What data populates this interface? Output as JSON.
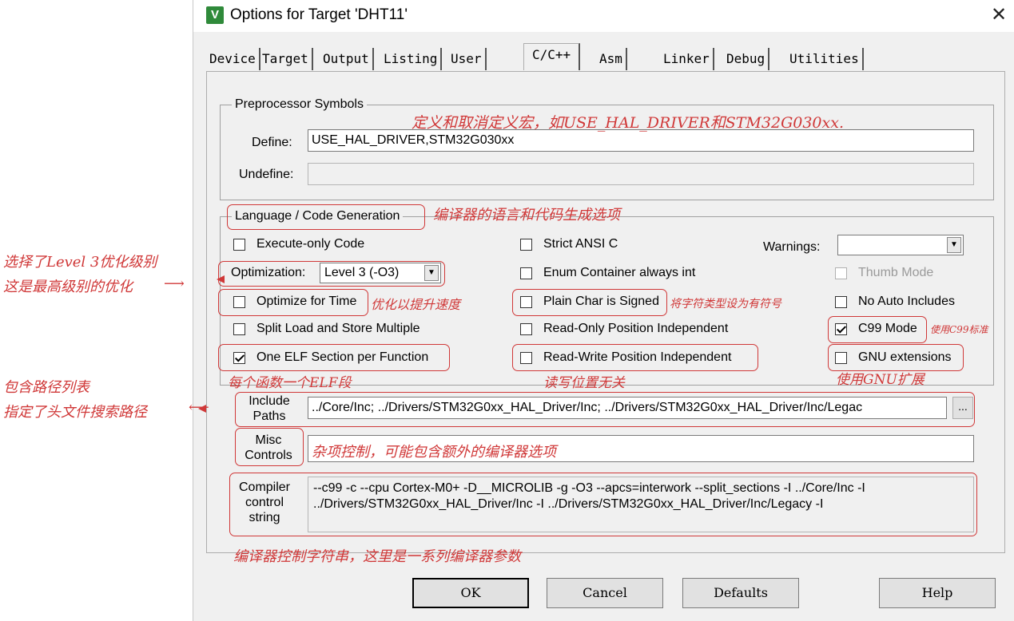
{
  "window": {
    "title": "Options for Target 'DHT11'",
    "icon_letter": "V",
    "close_glyph": "✕"
  },
  "tabs": [
    "Device",
    "Target",
    "Output",
    "Listing",
    "User",
    "C/C++",
    "Asm",
    "Linker",
    "Debug",
    "Utilities"
  ],
  "active_tab": "C/C++",
  "preprocessor": {
    "legend": "Preprocessor Symbols",
    "define_label": "Define:",
    "define_value": "USE_HAL_DRIVER,STM32G030xx",
    "undefine_label": "Undefine:",
    "undefine_value": ""
  },
  "language": {
    "legend": "Language / Code Generation",
    "execute_only": "Execute-only Code",
    "optimization_label": "Optimization:",
    "optimization_value": "Level 3 (-O3)",
    "optimize_time": "Optimize for Time",
    "split_load": "Split Load and Store Multiple",
    "one_elf": "One ELF Section per Function",
    "strict_ansi": "Strict ANSI C",
    "enum_container": "Enum Container always int",
    "plain_char": "Plain Char is Signed",
    "ro_pos": "Read-Only Position Independent",
    "rw_pos": "Read-Write Position Independent",
    "warnings_label": "Warnings:",
    "warnings_value": "",
    "thumb_mode": "Thumb Mode",
    "no_auto_includes": "No Auto Includes",
    "c99_mode": "C99 Mode",
    "gnu_ext": "GNU extensions"
  },
  "include": {
    "label": "Include Paths",
    "value": "../Core/Inc; ../Drivers/STM32G0xx_HAL_Driver/Inc; ../Drivers/STM32G0xx_HAL_Driver/Inc/Legac",
    "browse_label": "..."
  },
  "misc": {
    "label": "Misc Controls",
    "value": ""
  },
  "compiler": {
    "label": "Compiler control string",
    "line1": "--c99 -c --cpu Cortex-M0+ -D__MICROLIB -g -O3 --apcs=interwork --split_sections -I ../Core/Inc -I",
    "line2": "../Drivers/STM32G0xx_HAL_Driver/Inc -I ../Drivers/STM32G0xx_HAL_Driver/Inc/Legacy -I"
  },
  "buttons": {
    "ok": "OK",
    "cancel": "Cancel",
    "defaults": "Defaults",
    "help": "Help"
  },
  "annotations": {
    "define_note": "定义和取消定义宏，如USE_HAL_DRIVER和STM32G030xx.",
    "lang_note": "编译器的语言和代码生成选项",
    "opt_note_1": "选择了Level 3优化级别",
    "opt_note_2": "这是最高级别的优化",
    "time_note": "优化以提升速度",
    "char_note": "将字符类型设为有符号",
    "c99_note": "使用C99标准",
    "elf_note": "每个函数一个ELF段",
    "rw_note": "读写位置无关",
    "gnu_note": "使用GNU扩展",
    "inc_note_1": "包含路径列表",
    "inc_note_2": "指定了头文件搜索路径",
    "misc_note": "杂项控制，可能包含额外的编译器选项",
    "ctrl_note": "编译器控制字符串，这里是一系列编译器参数"
  }
}
